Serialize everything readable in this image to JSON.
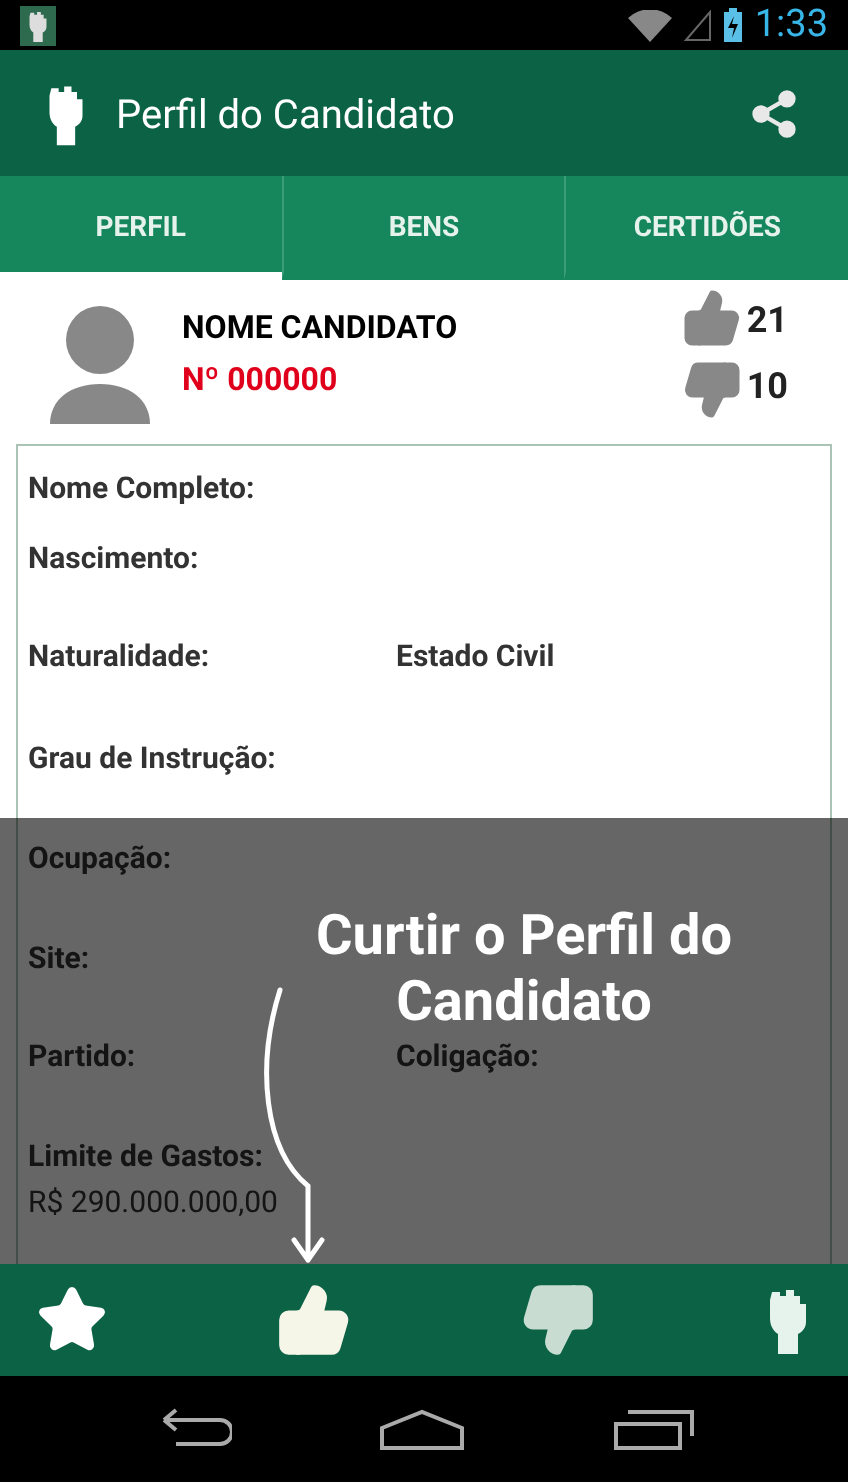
{
  "status_bar": {
    "time": "1:33"
  },
  "app_bar": {
    "title": "Perfil do Candidato"
  },
  "tabs": [
    {
      "label": "PERFIL",
      "selected": true
    },
    {
      "label": "BENS",
      "selected": false
    },
    {
      "label": "CERTIDÕES",
      "selected": false
    }
  ],
  "candidate": {
    "name": "NOME CANDIDATO",
    "number": "Nº 000000",
    "likes": "21",
    "dislikes": "10"
  },
  "fields": [
    {
      "kind": "single",
      "label": "Nome Completo:"
    },
    {
      "kind": "single",
      "label": "Nascimento:"
    },
    {
      "kind": "pair",
      "label": "Naturalidade:",
      "label_2": "Estado Civil"
    },
    {
      "kind": "single",
      "label": "Grau de Instrução:"
    },
    {
      "kind": "single",
      "label": "Ocupação:"
    },
    {
      "kind": "single",
      "label": "Site:"
    },
    {
      "kind": "pair",
      "label": "Partido:",
      "label_2": "Coligação:"
    },
    {
      "kind": "value",
      "label": "Limite de Gastos:",
      "value": "R$ 290.000.000,00"
    }
  ],
  "coach_mark": {
    "text": "Curtir o Perfil do Candidato"
  }
}
